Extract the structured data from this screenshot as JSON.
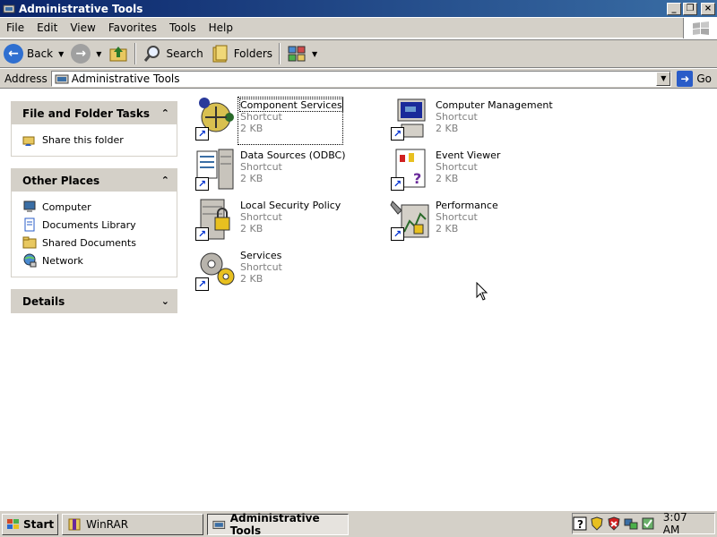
{
  "window": {
    "title": "Administrative Tools",
    "buttons": {
      "minimize": "_",
      "maximize": "❐",
      "close": "×"
    }
  },
  "menu": [
    "File",
    "Edit",
    "View",
    "Favorites",
    "Tools",
    "Help"
  ],
  "toolbar": {
    "back": "Back",
    "search": "Search",
    "folders": "Folders"
  },
  "address": {
    "label": "Address",
    "value": "Administrative Tools",
    "go": "Go"
  },
  "task_pane": {
    "file_folder_tasks": {
      "title": "File and Folder Tasks",
      "items": [
        {
          "label": "Share this folder",
          "icon": "share-folder-icon"
        }
      ]
    },
    "other_places": {
      "title": "Other Places",
      "items": [
        {
          "label": "Computer",
          "icon": "computer-icon"
        },
        {
          "label": "Documents Library",
          "icon": "documents-icon"
        },
        {
          "label": "Shared Documents",
          "icon": "folder-icon"
        },
        {
          "label": "Network",
          "icon": "network-icon"
        }
      ]
    },
    "details": {
      "title": "Details"
    }
  },
  "items": [
    {
      "name": "Component Services",
      "type": "Shortcut",
      "size": "2 KB",
      "icon": "component-services-icon"
    },
    {
      "name": "Computer Management",
      "type": "Shortcut",
      "size": "2 KB",
      "icon": "computer-management-icon"
    },
    {
      "name": "Data Sources (ODBC)",
      "type": "Shortcut",
      "size": "2 KB",
      "icon": "data-sources-icon"
    },
    {
      "name": "Event Viewer",
      "type": "Shortcut",
      "size": "2 KB",
      "icon": "event-viewer-icon"
    },
    {
      "name": "Local Security Policy",
      "type": "Shortcut",
      "size": "2 KB",
      "icon": "security-policy-icon"
    },
    {
      "name": "Performance",
      "type": "Shortcut",
      "size": "2 KB",
      "icon": "performance-icon"
    },
    {
      "name": "Services",
      "type": "Shortcut",
      "size": "2 KB",
      "icon": "services-icon"
    }
  ],
  "taskbar": {
    "start": "Start",
    "tasks": [
      {
        "label": "WinRAR",
        "active": false
      },
      {
        "label": "Administrative Tools",
        "active": true
      }
    ],
    "clock": "3:07 AM"
  }
}
